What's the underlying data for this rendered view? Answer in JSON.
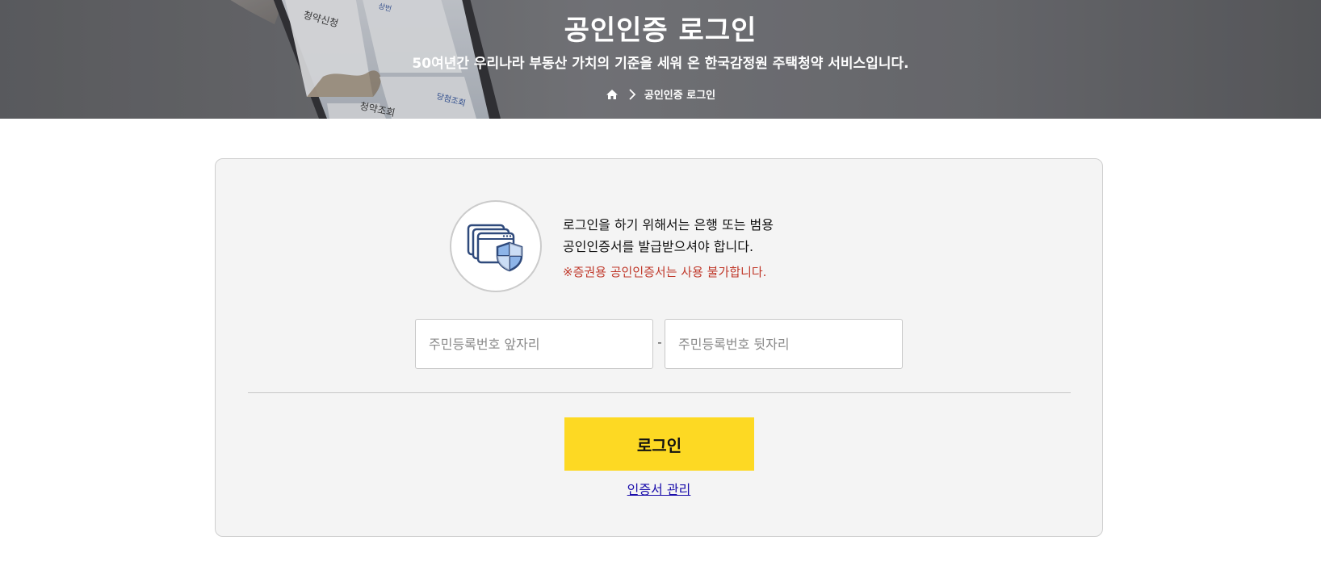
{
  "banner": {
    "title": "공인인증 로그인",
    "subtitle": "50여년간 우리나라 부동산 가치의 기준을 세워 온 한국감정원 주택청약 서비스입니다.",
    "breadcrumb": {
      "home_icon": "home-icon",
      "separator_icon": "chevron-right-icon",
      "current": "공인인증 로그인"
    },
    "photo_text": {
      "card_left_title": "청약신청",
      "card_right_label": "상번",
      "bottom_left": "청약조회",
      "bottom_right": "당첨조회"
    }
  },
  "login": {
    "cert_icon": "certificate-shield-icon",
    "info_line1": "로그인을 하기 위해서는 은행 또는 범용",
    "info_line2": "공인인증서를 발급받으셔야 합니다.",
    "warning": "※증권용 공인인증서는 사용 불가합니다.",
    "rrn_front": {
      "placeholder": "주민등록번호 앞자리",
      "value": ""
    },
    "rrn_separator": "-",
    "rrn_back": {
      "placeholder": "주민등록번호 뒷자리",
      "value": ""
    },
    "login_button": "로그인",
    "cert_manage_link": "인증서 관리"
  },
  "colors": {
    "button_bg": "#fdd923",
    "warning_text": "#c0392b",
    "link": "#1a0dab",
    "card_bg": "#f4f4f4"
  }
}
